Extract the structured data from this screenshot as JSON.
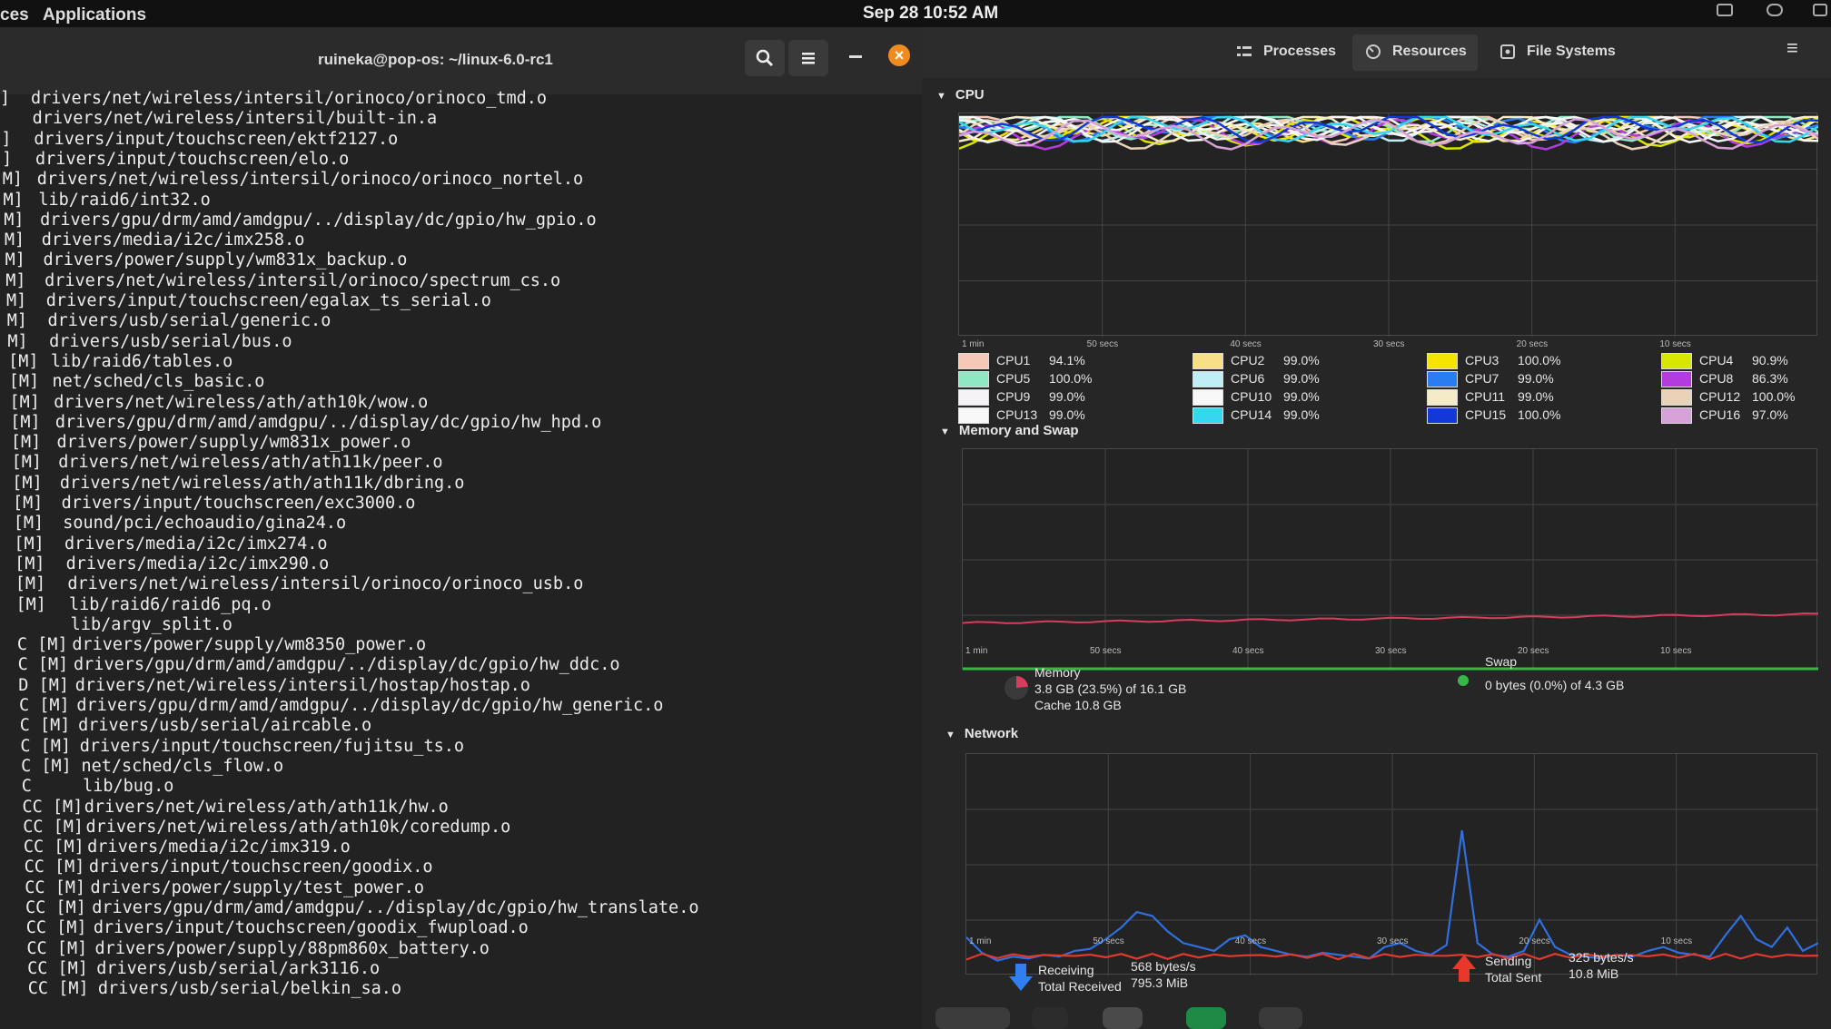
{
  "topbar": {
    "workspaces_label": "ces",
    "applications_label": "Applications",
    "datetime": "Sep 28  10:52 AM"
  },
  "terminal": {
    "title": "ruineka@pop-os: ~/linux-6.0-rc1",
    "lines": [
      {
        "prefix": "]",
        "path": "drivers/net/wireless/intersil/orinoco/orinoco_tmd.o"
      },
      {
        "prefix": "",
        "path": "drivers/net/wireless/intersil/built-in.a"
      },
      {
        "prefix": "]",
        "path": "drivers/input/touchscreen/ektf2127.o"
      },
      {
        "prefix": "]",
        "path": "drivers/input/touchscreen/elo.o"
      },
      {
        "prefix": "M]",
        "path": "drivers/net/wireless/intersil/orinoco/orinoco_nortel.o"
      },
      {
        "prefix": "M]",
        "path": "lib/raid6/int32.o"
      },
      {
        "prefix": "M]",
        "path": "drivers/gpu/drm/amd/amdgpu/../display/dc/gpio/hw_gpio.o"
      },
      {
        "prefix": "M]",
        "path": "drivers/media/i2c/imx258.o"
      },
      {
        "prefix": "M]",
        "path": "drivers/power/supply/wm831x_backup.o"
      },
      {
        "prefix": "M]",
        "path": "drivers/net/wireless/intersil/orinoco/spectrum_cs.o"
      },
      {
        "prefix": "M]",
        "path": "drivers/input/touchscreen/egalax_ts_serial.o"
      },
      {
        "prefix": "M]",
        "path": "drivers/usb/serial/generic.o"
      },
      {
        "prefix": "M]",
        "path": "drivers/usb/serial/bus.o"
      },
      {
        "prefix": "[M]",
        "path": "lib/raid6/tables.o"
      },
      {
        "prefix": "[M]",
        "path": "net/sched/cls_basic.o"
      },
      {
        "prefix": "[M]",
        "path": "drivers/net/wireless/ath/ath10k/wow.o"
      },
      {
        "prefix": "[M]",
        "path": "drivers/gpu/drm/amd/amdgpu/../display/dc/gpio/hw_hpd.o"
      },
      {
        "prefix": "[M]",
        "path": "drivers/power/supply/wm831x_power.o"
      },
      {
        "prefix": "[M]",
        "path": "drivers/net/wireless/ath/ath11k/peer.o"
      },
      {
        "prefix": "[M]",
        "path": "drivers/net/wireless/ath/ath11k/dbring.o"
      },
      {
        "prefix": "[M]",
        "path": "drivers/input/touchscreen/exc3000.o"
      },
      {
        "prefix": "[M]",
        "path": "sound/pci/echoaudio/gina24.o"
      },
      {
        "prefix": "[M]",
        "path": "drivers/media/i2c/imx274.o"
      },
      {
        "prefix": "[M]",
        "path": "drivers/media/i2c/imx290.o"
      },
      {
        "prefix": "[M]",
        "path": "drivers/net/wireless/intersil/orinoco/orinoco_usb.o"
      },
      {
        "prefix": "[M]",
        "path": "lib/raid6/raid6_pq.o"
      },
      {
        "prefix": "",
        "path": "lib/argv_split.o"
      },
      {
        "prefix": "C [M]",
        "path": "drivers/power/supply/wm8350_power.o"
      },
      {
        "prefix": "C [M]",
        "path": "drivers/gpu/drm/amd/amdgpu/../display/dc/gpio/hw_ddc.o"
      },
      {
        "prefix": "D [M]",
        "path": "drivers/net/wireless/intersil/hostap/hostap.o"
      },
      {
        "prefix": "C [M]",
        "path": "drivers/gpu/drm/amd/amdgpu/../display/dc/gpio/hw_generic.o"
      },
      {
        "prefix": "C [M]",
        "path": "drivers/usb/serial/aircable.o"
      },
      {
        "prefix": "C [M]",
        "path": "drivers/input/touchscreen/fujitsu_ts.o"
      },
      {
        "prefix": "C [M]",
        "path": "net/sched/cls_flow.o"
      },
      {
        "prefix": "C",
        "path": "lib/bug.o"
      },
      {
        "prefix": "CC [M]",
        "path": "drivers/net/wireless/ath/ath11k/hw.o"
      },
      {
        "prefix": "CC [M]",
        "path": "drivers/net/wireless/ath/ath10k/coredump.o"
      },
      {
        "prefix": "CC [M]",
        "path": "drivers/media/i2c/imx319.o"
      },
      {
        "prefix": "CC [M]",
        "path": "drivers/input/touchscreen/goodix.o"
      },
      {
        "prefix": "CC [M]",
        "path": "drivers/power/supply/test_power.o"
      },
      {
        "prefix": "CC [M]",
        "path": "drivers/gpu/drm/amd/amdgpu/../display/dc/gpio/hw_translate.o"
      },
      {
        "prefix": "CC [M]",
        "path": "drivers/input/touchscreen/goodix_fwupload.o"
      },
      {
        "prefix": "CC [M]",
        "path": "drivers/power/supply/88pm860x_battery.o"
      },
      {
        "prefix": "CC [M]",
        "path": "drivers/usb/serial/ark3116.o"
      },
      {
        "prefix": "CC [M]",
        "path": "drivers/usb/serial/belkin_sa.o"
      }
    ]
  },
  "monitor": {
    "tabs": [
      {
        "label": "Processes",
        "icon": "processes-icon"
      },
      {
        "label": "Resources",
        "icon": "gauge-icon"
      },
      {
        "label": "File Systems",
        "icon": "disk-icon"
      }
    ],
    "time_ticks": [
      "1 min",
      "50 secs",
      "40 secs",
      "30 secs",
      "20 secs",
      "10 secs"
    ],
    "cpu": {
      "title": "CPU",
      "cores": [
        {
          "name": "CPU1",
          "pct": "94.1%",
          "color": "#f6c8b8"
        },
        {
          "name": "CPU2",
          "pct": "99.0%",
          "color": "#f7df8a"
        },
        {
          "name": "CPU3",
          "pct": "100.0%",
          "color": "#f5e400"
        },
        {
          "name": "CPU4",
          "pct": "90.9%",
          "color": "#d8e600"
        },
        {
          "name": "CPU5",
          "pct": "100.0%",
          "color": "#8ee8c4"
        },
        {
          "name": "CPU6",
          "pct": "99.0%",
          "color": "#bfeef6"
        },
        {
          "name": "CPU7",
          "pct": "99.0%",
          "color": "#2a7df0"
        },
        {
          "name": "CPU8",
          "pct": "86.3%",
          "color": "#b43be0"
        },
        {
          "name": "CPU9",
          "pct": "99.0%",
          "color": "#f6f3f6"
        },
        {
          "name": "CPU10",
          "pct": "99.0%",
          "color": "#f8f8f8"
        },
        {
          "name": "CPU11",
          "pct": "99.0%",
          "color": "#f3ecc6"
        },
        {
          "name": "CPU12",
          "pct": "100.0%",
          "color": "#e8d2b8"
        },
        {
          "name": "CPU13",
          "pct": "99.0%",
          "color": "#f8f8f8"
        },
        {
          "name": "CPU14",
          "pct": "99.0%",
          "color": "#35d6f0"
        },
        {
          "name": "CPU15",
          "pct": "100.0%",
          "color": "#1239d8"
        },
        {
          "name": "CPU16",
          "pct": "97.0%",
          "color": "#d7a2d8"
        }
      ]
    },
    "memory": {
      "title": "Memory and Swap",
      "memory_label": "Memory",
      "memory_value": "3.8 GB (23.5%) of 16.1 GB",
      "cache_value": "Cache 10.8 GB",
      "memory_fraction": 0.235,
      "swap_label": "Swap",
      "swap_value": "0 bytes (0.0%) of 4.3 GB",
      "memory_color": "#d83c5c",
      "swap_color": "#35b846"
    },
    "network": {
      "title": "Network",
      "receiving_label": "Receiving",
      "receiving_value": "568 bytes/s",
      "total_received_label": "Total Received",
      "total_received_value": "795.3 MiB",
      "sending_label": "Sending",
      "sending_value": "325 bytes/s",
      "total_sent_label": "Total Sent",
      "total_sent_value": "10.8 MiB",
      "receive_color": "#2f6fe0",
      "send_color": "#e03a2f"
    }
  }
}
